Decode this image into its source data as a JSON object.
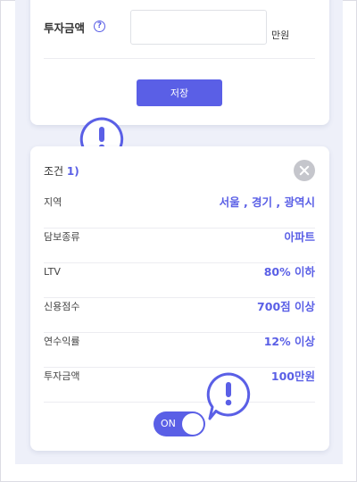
{
  "form": {
    "invest_label": "투자금액",
    "help_symbol": "?",
    "amount_value": "",
    "amount_placeholder": "",
    "unit": "만원",
    "save_label": "저장"
  },
  "condition": {
    "title": "조건",
    "number": "1)",
    "rows": [
      {
        "key": "지역",
        "value": "서울 , 경기 , 광역시"
      },
      {
        "key": "담보종류",
        "value": "아파트"
      },
      {
        "key": "LTV",
        "value": "80% 이하"
      },
      {
        "key": "신용점수",
        "value": "700점 이상"
      },
      {
        "key": "연수익률",
        "value": "12% 이상"
      },
      {
        "key": "투자금액",
        "value": "100만원"
      }
    ],
    "toggle_label": "ON"
  },
  "colors": {
    "accent": "#5a5fe6",
    "panel": "#eef0f9"
  },
  "icons": {
    "help": "question-circle-icon",
    "close": "close-circle-icon",
    "alert": "exclamation-bubble-icon"
  }
}
